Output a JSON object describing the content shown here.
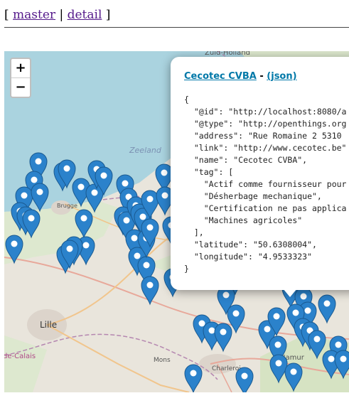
{
  "nav": {
    "open_bracket": "[",
    "master_label": "master",
    "separator": "|",
    "detail_label": "detail",
    "close_bracket": "]"
  },
  "map": {
    "labels": {
      "zuid_holland": "Zuid-Holland",
      "zeeland": "Zeeland",
      "brugge": "Brugge",
      "lille": "Lille",
      "mons": "Mons",
      "charleroi": "Charleroi",
      "namur": "Namur",
      "nord_pas_de_calais": "de-Calais"
    },
    "zoom_in": "+",
    "zoom_out": "−",
    "marker_color": "#2b82cb"
  },
  "popup": {
    "title_link": "Cecotec CVBA",
    "dash": " - ",
    "json_link": "(json)",
    "json_lines": [
      "{",
      "  \"@id\": \"http://localhost:8080/a",
      "  \"@type\": \"http://openthings.org",
      "  \"address\": \"Rue Romaine 2 5310",
      "  \"link\": \"http://www.cecotec.be\"",
      "  \"name\": \"Cecotec CVBA\",",
      "  \"tag\": [",
      "    \"Actif comme fournisseur pour",
      "    \"Désherbage mechanique\",",
      "    \"Certification ne pas applica",
      "    \"Machines agricoles\"",
      "  ],",
      "  \"latitude\": \"50.6308004\",",
      "  \"longitude\": \"4.9533323\"",
      "}"
    ]
  }
}
